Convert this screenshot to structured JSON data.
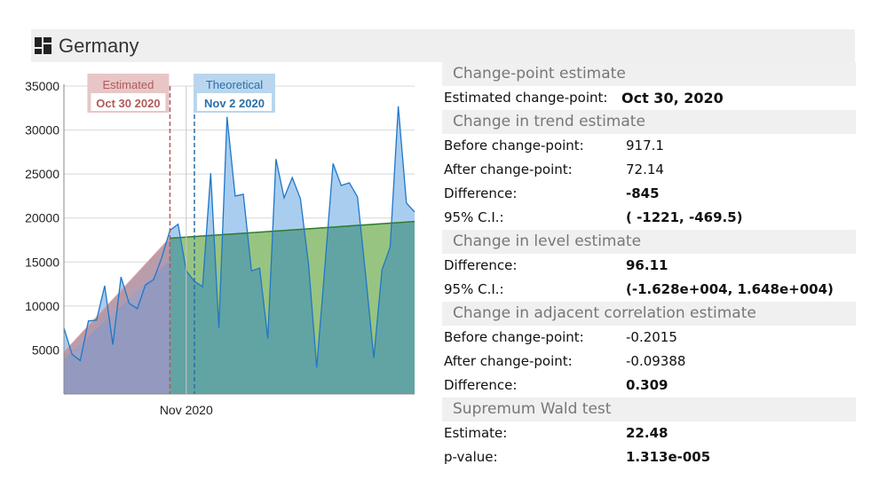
{
  "header": {
    "title": "Germany",
    "icon": "dashboard-icon"
  },
  "markers": {
    "estimated": {
      "label": "Estimated",
      "date": "Oct 30 2020",
      "color": "#b05a5a",
      "bg": "#e8c6c6"
    },
    "theoretical": {
      "label": "Theoretical",
      "date": "Nov 2 2020",
      "color": "#2a6fa8",
      "bg": "#b9d6ee"
    }
  },
  "chart_data": {
    "type": "area",
    "x_tick_label": "Nov 2020",
    "ylim": [
      0,
      35000
    ],
    "y_ticks": [
      5000,
      10000,
      15000,
      20000,
      25000,
      30000,
      35000
    ],
    "y_tick_labels": [
      "5000",
      "10000",
      "15000",
      "20000",
      "25000",
      "30000",
      "35000"
    ],
    "series": [
      {
        "values": [
          7500,
          4500,
          3800,
          8300,
          8400,
          12300,
          5600,
          13300,
          10300,
          9700,
          12400,
          13000,
          15500,
          18600,
          19300,
          14000,
          12800,
          12200,
          25100,
          7500,
          31500,
          22500,
          22700,
          14000,
          14300,
          6300,
          26700,
          22300,
          24600,
          22200,
          14700,
          3000,
          14500,
          26200,
          23700,
          24000,
          22400,
          13500,
          4100,
          14100,
          16700,
          32700,
          21700,
          20700
        ]
      }
    ],
    "trend_before": {
      "start": 4700,
      "end": 17700
    },
    "trend_after": {
      "start": 17700,
      "end": 19600
    },
    "change_index": 13,
    "theoretical_index": 16,
    "tick_index": 15,
    "colors": {
      "data": "#1f77c8",
      "data_fill": "#a9cdef",
      "before_fill": "#8f8fb6",
      "before_line": "#d39a9a",
      "after_fill": "#5aa09a",
      "after_line": "#2f7a2f",
      "green_fill": "#9dc77e"
    }
  },
  "stats": {
    "sections": [
      {
        "title": "Change-point estimate",
        "rows": [
          {
            "label": "Estimated change-point:",
            "value": "Oct 30, 2020",
            "bold": true,
            "wide": true
          }
        ]
      },
      {
        "title": "Change in trend estimate",
        "rows": [
          {
            "label": "Before change-point:",
            "value": "917.1",
            "bold": false
          },
          {
            "label": "After change-point:",
            "value": "72.14",
            "bold": false
          },
          {
            "label": "Difference:",
            "value": "-845",
            "bold": true
          },
          {
            "label": "95% C.I.:",
            "value": "( -1221, -469.5)",
            "bold": true
          }
        ]
      },
      {
        "title": "Change in level estimate",
        "rows": [
          {
            "label": "Difference:",
            "value": "96.11",
            "bold": true
          },
          {
            "label": "95% C.I.:",
            "value": "(-1.628e+004, 1.648e+004)",
            "bold": true
          }
        ]
      },
      {
        "title": "Change in adjacent correlation estimate",
        "rows": [
          {
            "label": "Before change-point:",
            "value": "-0.2015",
            "bold": false
          },
          {
            "label": "After change-point:",
            "value": "-0.09388",
            "bold": false
          },
          {
            "label": "Difference:",
            "value": "0.309",
            "bold": true
          }
        ]
      },
      {
        "title": "Supremum Wald test",
        "rows": [
          {
            "label": "Estimate:",
            "value": "22.48",
            "bold": true
          },
          {
            "label": "p-value:",
            "value": "1.313e-005",
            "bold": true
          }
        ]
      }
    ]
  }
}
